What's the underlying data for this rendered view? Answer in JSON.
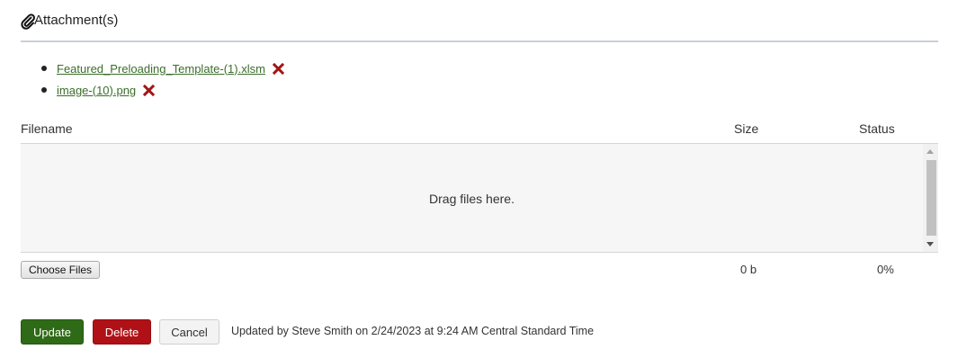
{
  "section": {
    "title": "Attachment(s)",
    "icon": "paperclip-icon"
  },
  "attachments": [
    {
      "name": "Featured_Preloading_Template-(1).xlsm"
    },
    {
      "name": "image-(10).png"
    }
  ],
  "upload": {
    "columns": {
      "filename": "Filename",
      "size": "Size",
      "status": "Status"
    },
    "drop_message": "Drag files here.",
    "choose_label": "Choose Files",
    "total_size": "0 b",
    "total_status": "0%"
  },
  "actions": {
    "update": "Update",
    "delete": "Delete",
    "cancel": "Cancel"
  },
  "updated_text": "Updated by Steve Smith on 2/24/2023 at 9:24 AM Central Standard Time",
  "colors": {
    "link": "#3a6e2a",
    "delete_x": "#a01515",
    "update_btn": "#2f6a16",
    "delete_btn": "#b01116"
  }
}
